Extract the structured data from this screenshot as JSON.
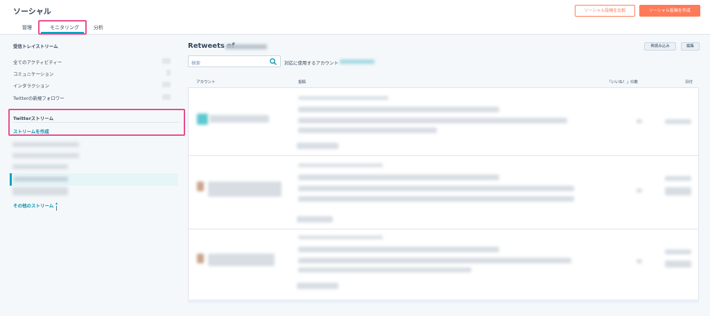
{
  "header": {
    "title": "ソーシャル",
    "tabs": [
      {
        "label": "管理"
      },
      {
        "label": "モニタリング"
      },
      {
        "label": "分析"
      }
    ],
    "compare_button": "ソーシャル投稿を比較",
    "create_button": "ソーシャル投稿を作成"
  },
  "sidebar": {
    "inbox_heading": "受信トレイストリーム",
    "inbox_items": [
      {
        "label": "全てのアクティビティー"
      },
      {
        "label": "コミュニケーション"
      },
      {
        "label": "インタラクション"
      },
      {
        "label": "Twitterの新規フォロワー"
      }
    ],
    "twitter_heading": "Twitterストリーム",
    "create_stream": "ストリームを作成",
    "more_streams": "その他のストリーム"
  },
  "main": {
    "title": "Retweets of",
    "reload_button": "再読み込み",
    "edit_button": "編集",
    "search_placeholder": "検索",
    "account_label": "対応に使用するアカウント",
    "columns": {
      "account": "アカウント",
      "post": "投稿",
      "likes": "「いいね！」の数",
      "date": "日付"
    }
  },
  "colors": {
    "accent": "#ff7a59",
    "teal": "#00a4bd",
    "highlight": "#e84a8a"
  }
}
